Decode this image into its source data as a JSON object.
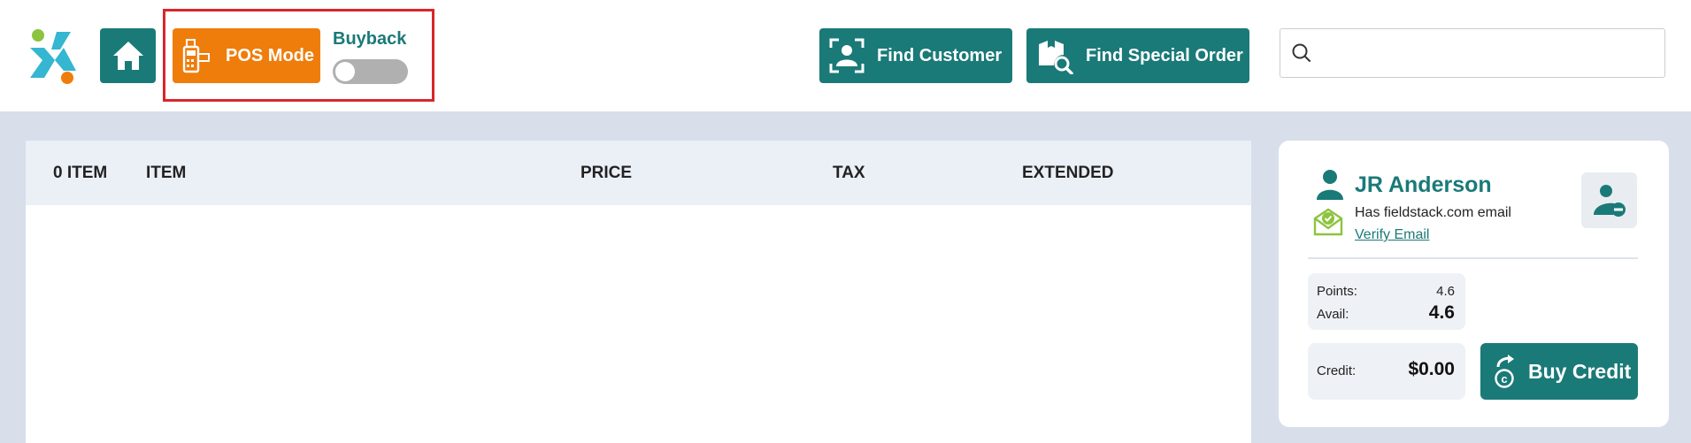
{
  "colors": {
    "teal": "#1a7a78",
    "orange": "#ef7d0b",
    "highlight": "#d9262c",
    "background": "#d8dfeb"
  },
  "header": {
    "logo_icon": "logo-icon",
    "home_icon": "home-icon",
    "pos_mode_label": "POS Mode",
    "pos_mode_icon": "card-terminal-icon",
    "buyback_label": "Buyback",
    "buyback_enabled": false,
    "find_customer_label": "Find Customer",
    "find_customer_icon": "scan-person-icon",
    "find_special_order_label": "Find Special Order",
    "find_special_order_icon": "box-search-icon",
    "search_icon": "search-icon",
    "search_value": "",
    "search_placeholder": ""
  },
  "items_table": {
    "columns": [
      "0 ITEM",
      "ITEM",
      "PRICE",
      "TAX",
      "EXTENDED"
    ],
    "rows": []
  },
  "customer": {
    "name": "JR Anderson",
    "email_note": "Has fieldstack.com email",
    "verify_email_label": "Verify Email",
    "points_label": "Points:",
    "points_value": "4.6",
    "avail_label": "Avail:",
    "avail_value": "4.6",
    "credit_label": "Credit:",
    "credit_value": "$0.00",
    "buy_credit_label": "Buy Credit"
  }
}
